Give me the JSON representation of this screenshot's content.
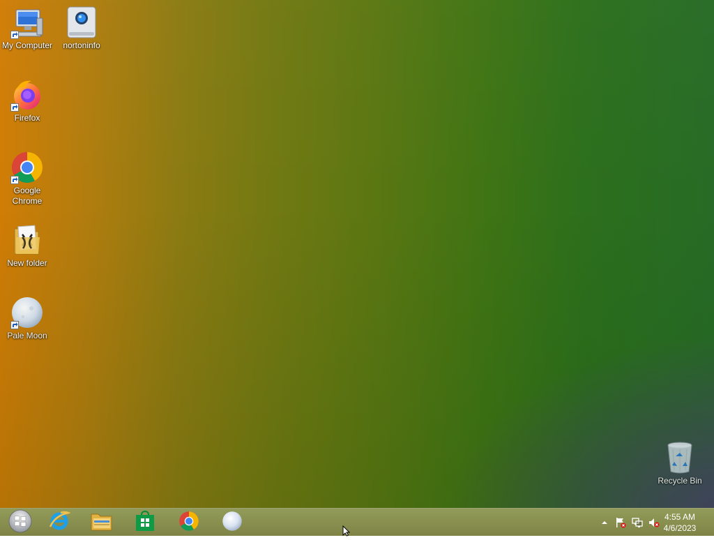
{
  "desktop": {
    "icons": [
      {
        "label": "My Computer",
        "icon": "computer-icon"
      },
      {
        "label": "nortoninfo",
        "icon": "norton-drive-icon"
      },
      {
        "label": "Firefox",
        "icon": "firefox-icon"
      },
      {
        "label": "Google Chrome",
        "icon": "chrome-icon"
      },
      {
        "label": "New folder",
        "icon": "folder-icon"
      },
      {
        "label": "Pale Moon",
        "icon": "pale-moon-icon"
      },
      {
        "label": "Recycle Bin",
        "icon": "recycle-bin-icon"
      }
    ]
  },
  "taskbar": {
    "pinned": [
      {
        "icon": "windows-start-icon"
      },
      {
        "icon": "internet-explorer-icon"
      },
      {
        "icon": "file-explorer-icon"
      },
      {
        "icon": "store-icon"
      },
      {
        "icon": "chrome-icon"
      },
      {
        "icon": "pale-moon-icon"
      }
    ],
    "tray": {
      "icons": [
        "show-hidden-icons-arrow",
        "action-center-flag-icon",
        "network-icon",
        "volume-muted-icon"
      ],
      "time": "4:55 AM",
      "date": "4/6/2023"
    }
  },
  "colors": {
    "wallpaper_left": "#d07d06",
    "wallpaper_right": "#276b26",
    "taskbar": "#8c9650"
  }
}
